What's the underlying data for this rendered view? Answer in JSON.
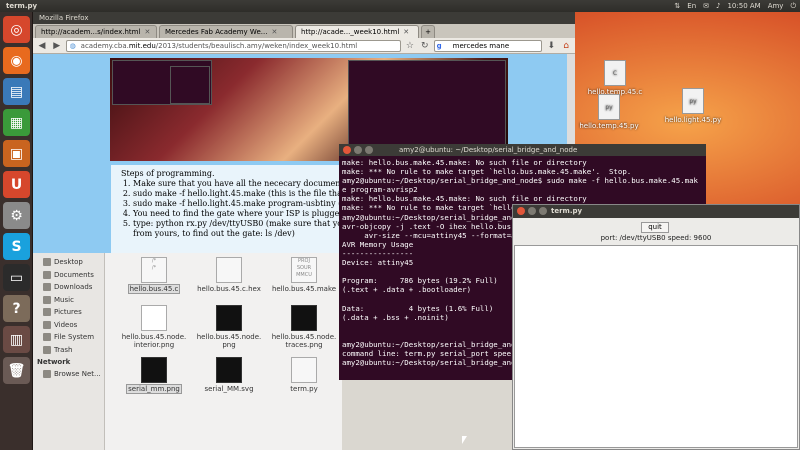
{
  "top_panel": {
    "app_title": "term.py",
    "clock": "10:50 AM",
    "user": "Amy"
  },
  "launcher": {
    "items": [
      "ubuntu-icon",
      "firefox-icon",
      "writer-icon",
      "calc-icon",
      "impress-icon",
      "ubuntu-one-icon",
      "settings-icon",
      "skype-icon",
      "terminal-icon",
      "help-icon",
      "workspaces-icon",
      "trash-icon"
    ]
  },
  "desktop_icons": [
    "hello.temp.45.c",
    "hello.temp.45.py",
    "hello.light.45.py"
  ],
  "desktop_folder": "serial_bridge_and_node",
  "firefox": {
    "window_title": "Mozilla Firefox",
    "tabs": [
      "http://academ...s/index.html",
      "Mercedes Fab Academy We...",
      "http://acade..._week10.html"
    ],
    "url_prefix": "academy.cba.",
    "url_domain": "mit.edu",
    "url_suffix": "/2013/students/beaulisch.amy/weken/index_week10.html",
    "search_value": "mercedes mane",
    "steps_title": "Steps of programming.",
    "steps": [
      "Make sure that you have all the nececary documents (",
      "sudo make -f hello.light.45.make (this is the file that be",
      "sudo make -f hello.light.45.make program-usbtiny (This",
      "You need to find the gate where your ISP is plugged in",
      "type: python rx.py /dev/ttyUSB0 (make sure that you h"
    ],
    "steps_tail": "from yours, to find out the gate: ls /dev)"
  },
  "file_manager": {
    "sidebar_places": [
      "Desktop",
      "Documents",
      "Downloads",
      "Music",
      "Pictures",
      "Videos",
      "File System",
      "Trash"
    ],
    "network_heading": "Network",
    "network_items": [
      "Browse Net..."
    ],
    "files": [
      "hello.bus.45.c",
      "hello.bus.45.c.hex",
      "hello.bus.45.make",
      "hello.bus.45.node.\ninterior.png",
      "hello.bus.45.node.\npng",
      "hello.bus.45.node.\ntraces.png",
      "serial_mm.png",
      "serial_MM.svg",
      "term.py"
    ]
  },
  "terminal": {
    "title": "amy2@ubuntu: ~/Desktop/serial_bridge_and_node",
    "lines": [
      "make: hello.bus.make.45.make: No such file or directory",
      "make: *** No rule to make target `hello.bus.make.45.make'.  Stop.",
      "amy2@ubuntu:~/Desktop/serial_bridge_and_node$ sudo make -f hello.bus.make.45.mak",
      "e program-avrisp2",
      "make: hello.bus.make.45.make: No such file or directory",
      "make: *** No rule to make target `hello",
      "amy2@ubuntu:~/Desktop/serial_bridge_and",
      "avr-objcopy -j .text -O ihex hello.bus",
      "     avr-size --mcu=attiny45 --format=av",
      "AVR Memory Usage",
      "----------------",
      "Device: attiny45",
      "",
      "Program:     786 bytes (19.2% Full)",
      "(.text + .data + .bootloader)",
      "",
      "Data:          4 bytes (1.6% Full)",
      "(.data + .bss + .noinit)",
      "",
      "",
      "amy2@ubuntu:~/Desktop/serial_bridge_and",
      "command line: term.py serial_port spee",
      "amy2@ubuntu:~/Desktop/serial_bridge_and"
    ]
  },
  "termpy": {
    "title": "term.py",
    "quit_label": "quit",
    "port_text": "port: /dev/ttyUSB0   speed: 9600"
  }
}
